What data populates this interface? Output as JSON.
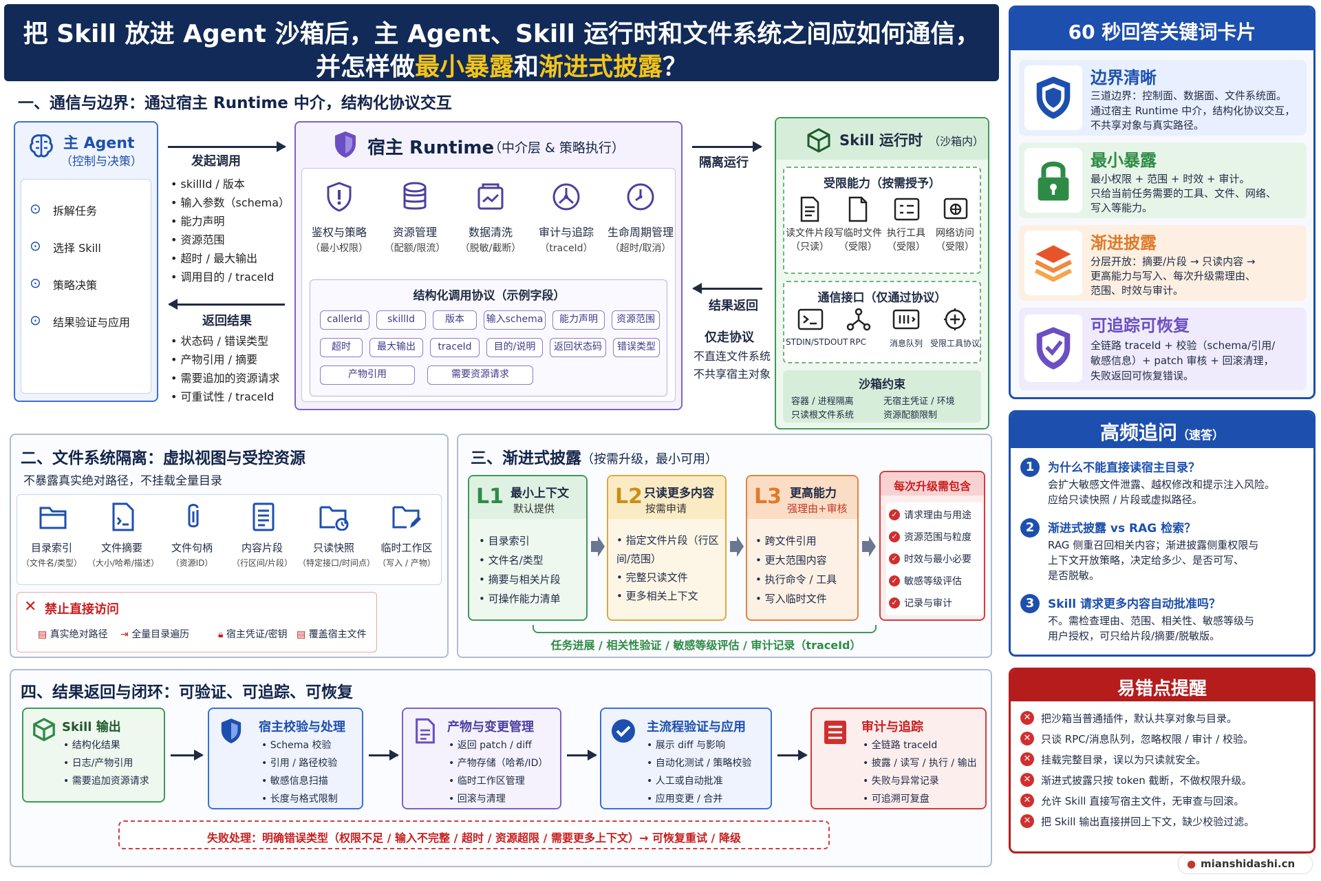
{
  "title": {
    "line1": "把 Skill 放进 Agent 沙箱后，主 Agent、Skill 运行时和文件系统之间应如何通信，",
    "line2_pre": "并怎样做",
    "line2_h1": "最小暴露",
    "line2_mid": "和",
    "line2_h2": "渐进式披露",
    "line2_post": "？"
  },
  "colors": {
    "navy": "#112a57",
    "yellow": "#f5c518",
    "blue": "#1d4fae",
    "red": "#c81e1e",
    "green": "#2e8b45",
    "purple": "#6b4fc2",
    "orange": "#e07a2a"
  },
  "s1": {
    "heading": "一、通信与边界：通过宿主 Runtime 中介，结构化协议交互",
    "main_agent": {
      "title": "主 Agent",
      "subtitle": "（控制与决策）",
      "items": [
        "拆解任务",
        "选择 Skill",
        "策略决策",
        "结果验证与应用"
      ]
    },
    "invoke": {
      "title": "发起调用",
      "items": [
        "skillId / 版本",
        "输入参数（schema）",
        "能力声明",
        "资源范围",
        "超时 / 最大输出",
        "调用目的 / traceId"
      ]
    },
    "ret": {
      "title": "返回结果",
      "items": [
        "状态码 / 错误类型",
        "产物引用 / 摘要",
        "需要追加的资源请求",
        "可重试性 / traceId"
      ]
    },
    "runtime": {
      "title": "宿主 Runtime",
      "subtitle": "（中介层 & 策略执行）",
      "funcs": [
        {
          "name": "鉴权与策略",
          "sub": "（最小权限）",
          "icon": "shield-alert-icon"
        },
        {
          "name": "资源管理",
          "sub": "（配额/限流）",
          "icon": "database-icon"
        },
        {
          "name": "数据清洗",
          "sub": "（脱敏/截断）",
          "icon": "clean-data-icon"
        },
        {
          "name": "审计与追踪",
          "sub": "（traceId）",
          "icon": "trace-icon"
        },
        {
          "name": "生命周期管理",
          "sub": "（超时/取消）",
          "icon": "clock-icon"
        }
      ],
      "proto_title": "结构化调用协议（示例字段）",
      "proto_row1": [
        "callerId",
        "skillId",
        "版本",
        "输入schema",
        "能力声明",
        "资源范围"
      ],
      "proto_row2": [
        "超时",
        "最大输出",
        "traceId",
        "目的/说明",
        "返回状态码",
        "错误类型"
      ],
      "proto_row3": [
        "产物引用",
        "需要资源请求"
      ]
    },
    "isolated_run": "隔离运行",
    "result_return": "结果返回",
    "only_proto": "仅走协议",
    "no_fs": "不直连文件系统",
    "no_share": "不共享宿主对象",
    "skill_rt": {
      "title": "Skill 运行时",
      "subtitle": "（沙箱内）",
      "cap_title": "受限能力（按需授予）",
      "caps": [
        {
          "name": "读文件片段",
          "sub": "（只读）"
        },
        {
          "name": "写临时文件",
          "sub": "（受限）"
        },
        {
          "name": "执行工具",
          "sub": "（受限）"
        },
        {
          "name": "网络访问",
          "sub": "（受限）"
        }
      ],
      "comm_title": "通信接口（仅通过协议）",
      "comms": [
        "STDIN/STDOUT",
        "RPC",
        "消息队列",
        "受限工具协议"
      ],
      "constraint_title": "沙箱约束",
      "constraints": [
        "容器 / 进程隔离",
        "无宿主凭证 / 环境",
        "只读根文件系统",
        "资源配额限制"
      ]
    }
  },
  "s2": {
    "heading": "二、文件系统隔离：虚拟视图与受控资源",
    "sub": "不暴露真实绝对路径，不挂载全量目录",
    "items": [
      {
        "name": "目录索引",
        "sub": "（文件名/类型）"
      },
      {
        "name": "文件摘要",
        "sub": "（大小/哈希/描述）"
      },
      {
        "name": "文件句柄",
        "sub": "（资源ID）"
      },
      {
        "name": "内容片段",
        "sub": "（行区间/片段）"
      },
      {
        "name": "只读快照",
        "sub": "（特定接口/时间点）"
      },
      {
        "name": "临时工作区",
        "sub": "（写入 / 产物）"
      }
    ],
    "forbid_title": "禁止直接访问",
    "forbids": [
      "真实绝对路径",
      "全量目录遍历",
      "宿主凭证/密钥",
      "覆盖宿主文件"
    ]
  },
  "s3": {
    "heading": "三、渐进式披露",
    "heading_sub": "（按需升级，最小可用）",
    "levels": [
      {
        "tag": "L1",
        "title": "最小上下文",
        "sub": "默认提供",
        "items": [
          "目录索引",
          "文件名/类型",
          "摘要与相关片段",
          "可操作能力清单"
        ]
      },
      {
        "tag": "L2",
        "title": "只读更多内容",
        "sub": "按需申请",
        "items": [
          "指定文件片段（行区间/范围）",
          "完整只读文件",
          "更多相关上下文"
        ]
      },
      {
        "tag": "L3",
        "title": "更高能力",
        "sub": "强理由+审核",
        "items": [
          "跨文件引用",
          "更大范围内容",
          "执行命令 / 工具",
          "写入临时文件"
        ]
      }
    ],
    "upgrade_title": "每次升级需包含",
    "upgrade_items": [
      "请求理由与用途",
      "资源范围与粒度",
      "时效与最小必要",
      "敏感等级评估",
      "记录与审计"
    ],
    "footer": "任务进展 / 相关性验证 / 敏感等级评估 / 审计记录（traceId）"
  },
  "s4": {
    "heading": "四、结果返回与闭环：可验证、可追踪、可恢复",
    "steps": [
      {
        "title": "Skill 输出",
        "items": [
          "结构化结果",
          "日志/产物引用",
          "需要追加资源请求"
        ]
      },
      {
        "title": "宿主校验与处理",
        "items": [
          "Schema 校验",
          "引用 / 路径校验",
          "敏感信息扫描",
          "长度与格式限制"
        ]
      },
      {
        "title": "产物与变更管理",
        "items": [
          "返回 patch / diff",
          "产物存储（哈希/ID）",
          "临时工作区管理",
          "回滚与清理"
        ]
      },
      {
        "title": "主流程验证与应用",
        "items": [
          "展示 diff 与影响",
          "自动化测试 / 策略校验",
          "人工或自动批准",
          "应用变更 / 合并"
        ]
      },
      {
        "title": "审计与追踪",
        "items": [
          "全链路 traceId",
          "披露 / 读写 / 执行 / 输出",
          "失败与异常记录",
          "可追溯可复盘"
        ]
      }
    ],
    "fail": "失败处理：明确错误类型（权限不足 / 输入不完整 / 超时 / 资源超限 / 需要更多上下文）→ 可恢复重试 / 降级"
  },
  "right": {
    "card_title": "60 秒回答关键词卡片",
    "keys": [
      {
        "title": "边界清晰",
        "lines": [
          "三道边界：控制面、数据面、文件系统面。",
          "通过宿主 Runtime 中介，结构化协议交互，",
          "不共享对象与真实路径。"
        ]
      },
      {
        "title": "最小暴露",
        "lines": [
          "最小权限 + 范围 + 时效 + 审计。",
          "只给当前任务需要的工具、文件、网络、",
          "写入等能力。"
        ]
      },
      {
        "title": "渐进披露",
        "lines": [
          "分层开放：摘要/片段 → 只读内容 →",
          "更高能力与写入、每次升级需理由、",
          "范围、时效与审计。"
        ]
      },
      {
        "title": "可追踪可恢复",
        "lines": [
          "全链路 traceId + 校验（schema/引用/",
          "敏感信息）+ patch 审核 + 回滚清理，",
          "失败返回可恢复错误。"
        ]
      }
    ],
    "faq_title": "高频追问",
    "faq_sub": "（速答）",
    "faqs": [
      {
        "q": "为什么不能直接读宿主目录？",
        "a": [
          "会扩大敏感文件泄露、越权修改和提示注入风险。",
          "应给只读快照 / 片段或虚拟路径。"
        ]
      },
      {
        "q": "渐进式披露 vs RAG 检索？",
        "a": [
          "RAG 侧重召回相关内容；渐进披露侧重权限与",
          "上下文开放策略，决定给多少、是否可写、",
          "是否脱敏。"
        ]
      },
      {
        "q": "Skill 请求更多内容自动批准吗？",
        "a": [
          "不。需检查理由、范围、相关性、敏感等级与",
          "用户授权，可只给片段/摘要/脱敏版。"
        ]
      }
    ],
    "pitfall_title": "易错点提醒",
    "pitfalls": [
      "把沙箱当普通插件，默认共享对象与目录。",
      "只谈 RPC/消息队列，忽略权限 / 审计 / 校验。",
      "挂载完整目录，误以为只读就安全。",
      "渐进式披露只按 token 截断，不做权限升级。",
      "允许 Skill 直接写宿主文件，无审查与回滚。",
      "把 Skill 输出直接拼回上下文，缺少校验过滤。"
    ]
  },
  "watermark": "mianshidashi.cn"
}
